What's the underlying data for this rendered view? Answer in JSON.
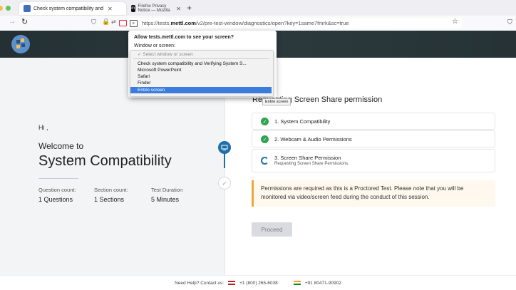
{
  "browser": {
    "tabs": [
      {
        "title": "Check system compatibility and",
        "active": true
      },
      {
        "title": "Firefox Privacy Notice — Mozilla",
        "active": false
      }
    ],
    "new_tab": "+",
    "url_prefix": "https://tests.",
    "url_domain": "mettl.com",
    "url_path": "/v2/pre-test-window/diagnostics/open?key=1same7fmrk&sc=true"
  },
  "popup": {
    "title": "Allow tests.mettl.com to see your screen?",
    "label": "Window or screen:",
    "options": [
      {
        "label": "✓ Select window or screen",
        "state": "placeholder"
      },
      {
        "label": "Check system compatibility and Verifying System S...",
        "state": "normal"
      },
      {
        "label": "Microsoft PowerPoint",
        "state": "normal"
      },
      {
        "label": "Safari",
        "state": "normal"
      },
      {
        "label": "Finder",
        "state": "normal"
      },
      {
        "label": "Entire screen",
        "state": "selected"
      }
    ],
    "tooltip": "Entire screen"
  },
  "left": {
    "greeting": "Hi ,",
    "welcome": "Welcome to",
    "title": "System Compatibility",
    "stats": [
      {
        "label": "Question count:",
        "value": "1 Questions"
      },
      {
        "label": "Section count:",
        "value": "1 Sections"
      },
      {
        "label": "Test Duration",
        "value": "5  Minutes"
      }
    ]
  },
  "right": {
    "heading": "Requesting Screen Share permission",
    "steps": [
      {
        "label": "1. System Compatibility",
        "sub": "",
        "status": "done"
      },
      {
        "label": "2. Webcam & Audio Permissions",
        "sub": "",
        "status": "done"
      },
      {
        "label": "3. Screen Share Permission",
        "sub": "Requesting Screen Share Permissions.",
        "status": "loading"
      }
    ],
    "notice": "Permissions are required as this is a Proctored Test. Please note that you will be monitored via video/screen feed during the conduct of this session.",
    "proceed": "Proceed"
  },
  "footer": {
    "help": "Need Help? Contact us:",
    "us_phone": "+1 (800) 265-6038",
    "in_phone": "+91 80471-90902"
  },
  "colors": {
    "accent": "#1f6fa8",
    "success": "#2ea44f",
    "warning": "#f0a43c",
    "selected": "#3b7ddd"
  }
}
